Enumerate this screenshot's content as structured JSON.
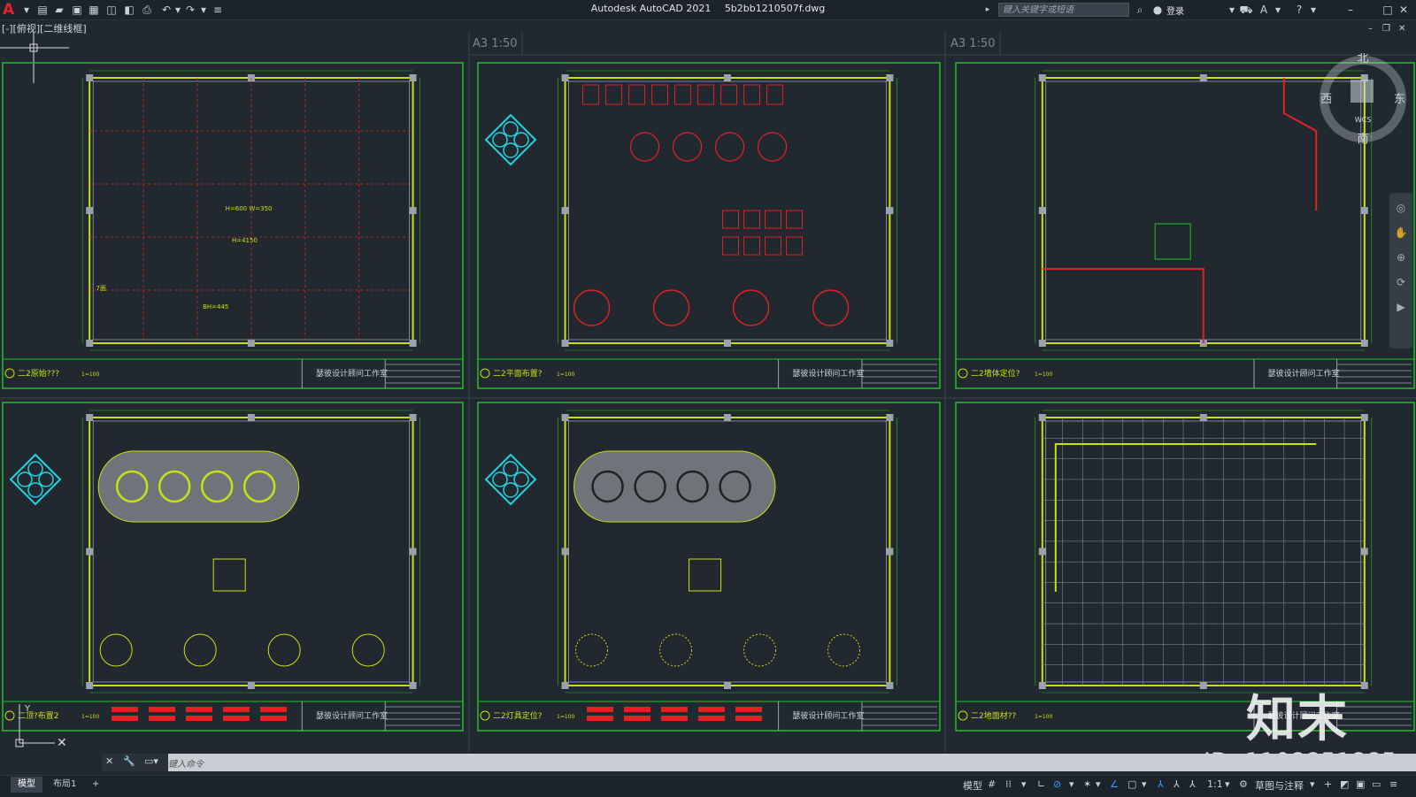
{
  "app": {
    "title": "Autodesk AutoCAD 2021",
    "filename": "5b2bb1210507f.dwg",
    "search_placeholder": "键入关键字或短语",
    "login_label": "登录"
  },
  "viewport": {
    "label": "[-][俯视][二维线框]"
  },
  "layouts": {
    "scale_labels": [
      "A3  1:50",
      "A3  1:50"
    ]
  },
  "sheets": [
    {
      "caption": "二2原始???",
      "scale": "1=100",
      "company": "瑟彼设计顾问工作室",
      "notes": [
        "H=600 W=350",
        "H=4150",
        "7面",
        "BH=445"
      ]
    },
    {
      "caption": "二2平面布置?",
      "scale": "1=100",
      "company": "瑟彼设计顾问工作室",
      "notes": []
    },
    {
      "caption": "二2墙体定位?",
      "scale": "1=100",
      "company": "瑟彼设计顾问工作室",
      "notes": []
    },
    {
      "caption": "二顶?布置2",
      "scale": "1=100",
      "company": "瑟彼设计顾问工作室",
      "notes": []
    },
    {
      "caption": "二2灯具定位?",
      "scale": "1=100",
      "company": "瑟彼设计顾问工作室",
      "notes": []
    },
    {
      "caption": "二2地面材??",
      "scale": "1=100",
      "company": "瑟彼设计顾问工作室",
      "notes": []
    }
  ],
  "compass": {
    "north": "北",
    "south": "南",
    "east": "东",
    "west": "西",
    "wcs": "WCS"
  },
  "command": {
    "placeholder": "键入命令"
  },
  "tabs": {
    "model": "模型",
    "layout1": "布局1",
    "add": "+"
  },
  "status": {
    "model": "模型",
    "scale": "1:1",
    "workspace": "草图与注释"
  },
  "watermark": {
    "logo": "知末",
    "id": "ID: 1108851885"
  },
  "colors": {
    "frame": "#1fc21f",
    "wall": "#c9e012",
    "accent_red": "#e02222",
    "cyan": "#22d4e0",
    "bg": "#212830"
  }
}
